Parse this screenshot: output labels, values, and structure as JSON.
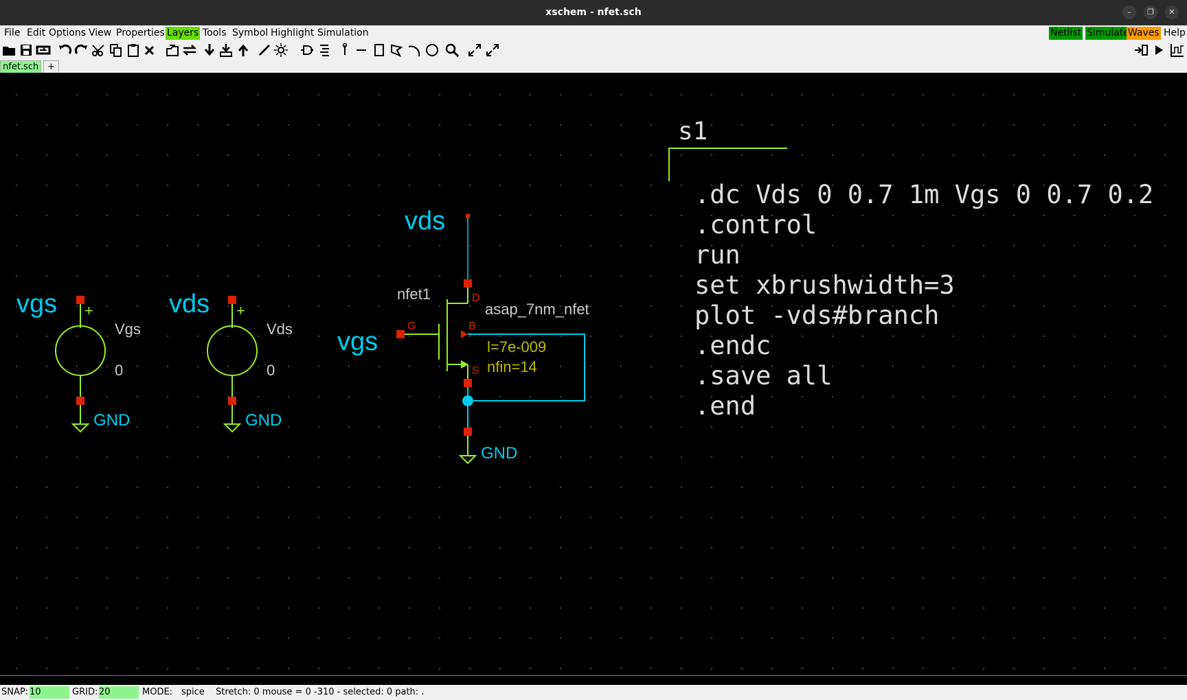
{
  "window": {
    "title": "xschem - nfet.sch",
    "minimize": "–",
    "maximize": "❐",
    "close": "✕"
  },
  "menu": {
    "items": [
      "File",
      "Edit",
      "Options",
      "View",
      "Properties",
      "Layers",
      "Tools",
      "Symbol",
      "Highlight",
      "Simulation"
    ],
    "right": {
      "netlist": "Netlist",
      "simulate": "Simulate",
      "waves": "Waves",
      "help": "Help"
    }
  },
  "tabs": {
    "active": "nfet.sch",
    "add": "+"
  },
  "schematic": {
    "v1": {
      "net": "vgs",
      "name": "Vgs",
      "value": "0",
      "plus": "+",
      "gnd": "GND"
    },
    "v2": {
      "net": "vds",
      "name": "Vds",
      "value": "0",
      "plus": "+",
      "gnd": "GND"
    },
    "fet": {
      "drain_net": "vds",
      "gate_net": "vgs",
      "name": "nfet1",
      "model": "asap_7nm_nfet",
      "pin_d": "D",
      "pin_g": "G",
      "pin_b": "B",
      "pin_s": "S",
      "param_l": "l=7e-009",
      "param_nfin": "nfin=14",
      "gnd": "GND"
    },
    "code": {
      "name": "s1",
      "lines": [
        ".dc Vds 0 0.7 1m Vgs 0 0.7 0.2",
        ".control",
        "run",
        "set xbrushwidth=3",
        "plot -vds#branch",
        ".endc",
        ".save all",
        ".end"
      ]
    }
  },
  "status": {
    "snap_label": "SNAP:",
    "snap_value": "10",
    "grid_label": "GRID:",
    "grid_value": "20",
    "mode_label": "MODE:",
    "mode_value": "spice",
    "info": "Stretch: 0  mouse = 0 -310 - selected: 0 path: ."
  },
  "colors": {
    "wire": "#00ccee",
    "symbol": "#99ee22",
    "pin": "#dd2200",
    "label": "#00ccee",
    "attr": "#cccccc",
    "param": "#bbbb00",
    "code": "#dddddd"
  }
}
